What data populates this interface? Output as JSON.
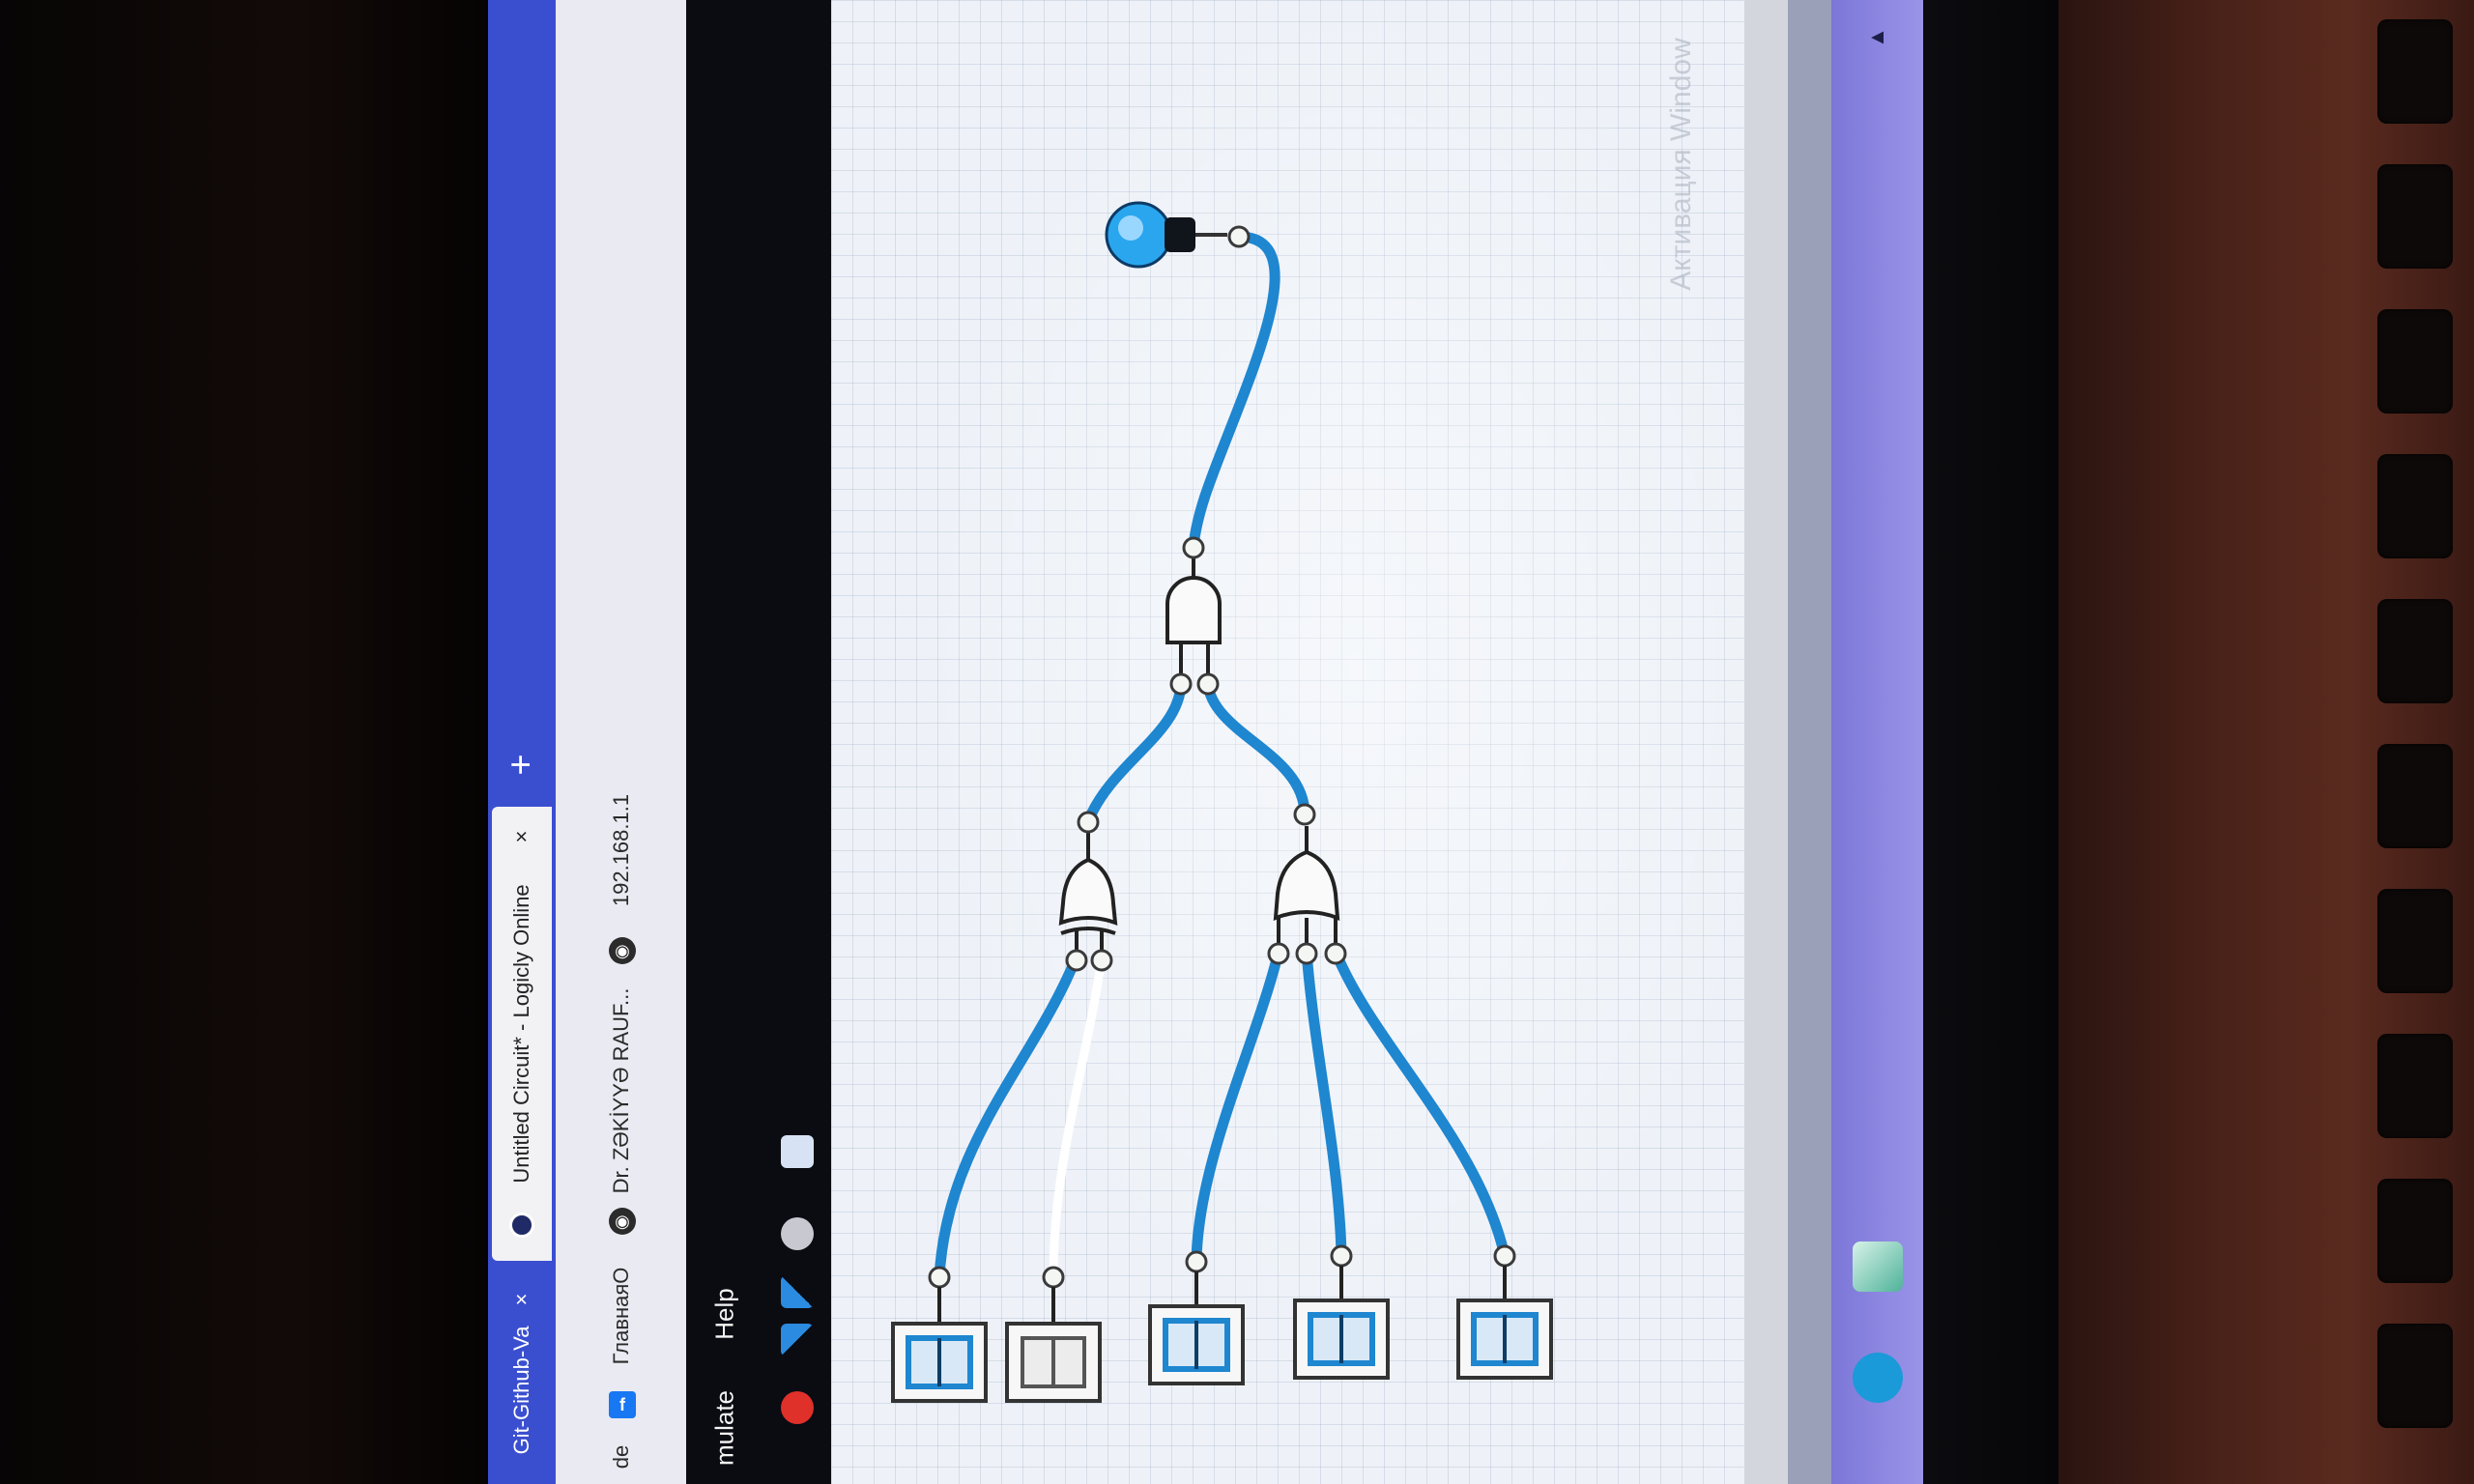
{
  "browser": {
    "tabs": [
      {
        "label": "Git-Github-Va",
        "close": "×",
        "active": false
      },
      {
        "label": "Untitled Circuit* - Logicly Online",
        "close": "×",
        "active": true
      }
    ],
    "new_tab": "+",
    "bookmarks": [
      {
        "label": "de",
        "icon": ""
      },
      {
        "label": "ГлавнаяO",
        "icon": "f"
      },
      {
        "label": "Dr. ZƏKİYYƏ RAUF...",
        "icon": "◉"
      },
      {
        "label": "192.168.1.1",
        "icon": "◉"
      }
    ]
  },
  "app": {
    "menu": [
      {
        "label": "mulate"
      },
      {
        "label": "Help"
      }
    ]
  },
  "circuit": {
    "output": {
      "name": "light-bulb",
      "state": "on"
    },
    "gates": [
      {
        "id": "and-gate",
        "type": "AND"
      },
      {
        "id": "xor-gate",
        "type": "XOR"
      },
      {
        "id": "or-gate",
        "type": "OR"
      }
    ],
    "switches": [
      {
        "id": "switch-1",
        "state": "on"
      },
      {
        "id": "switch-2",
        "state": "off"
      },
      {
        "id": "switch-3",
        "state": "on"
      },
      {
        "id": "switch-4",
        "state": "on"
      },
      {
        "id": "switch-5",
        "state": "on"
      }
    ]
  },
  "system": {
    "watermark": "Активация Window"
  },
  "colors": {
    "wire_on": "#1f86d0",
    "wire_off": "#ffffff",
    "tab_strip": "#3a4fd0",
    "taskbar": "#8a84e0"
  }
}
